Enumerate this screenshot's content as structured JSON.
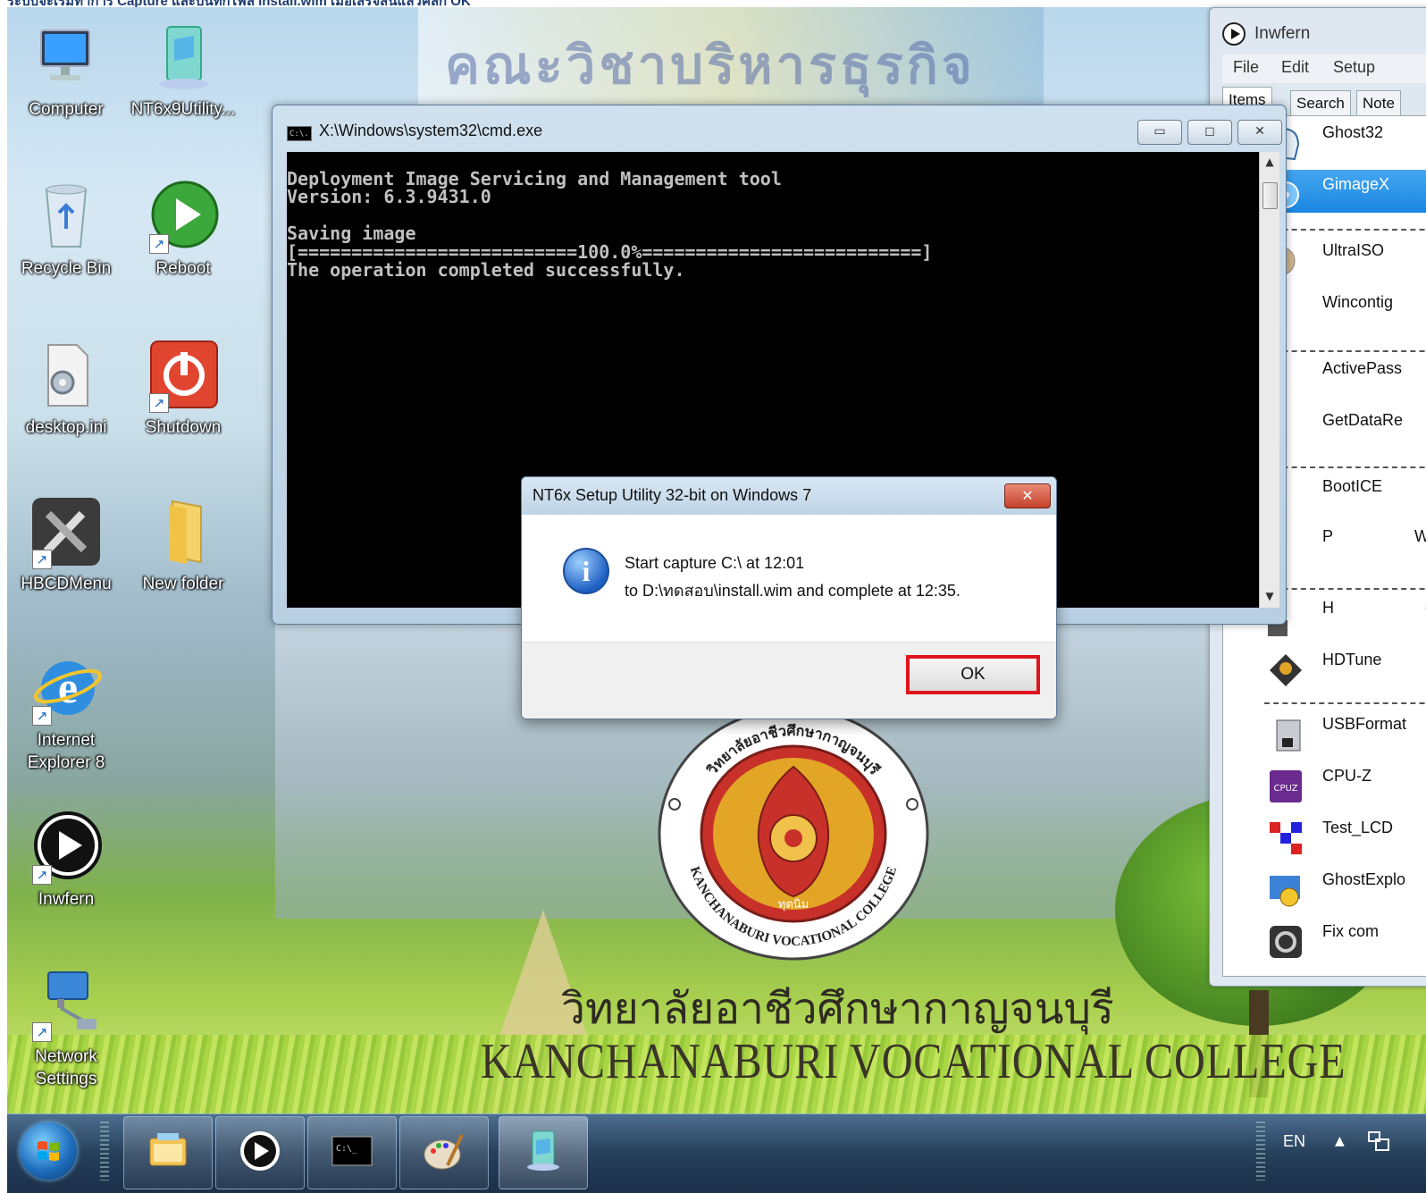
{
  "caption": {
    "text": "ระบบจะเริ่มทำการ Capture และบันทึกไฟล์ install.wim เมื่อเสร็จสิ้นแล้วคลิก OK"
  },
  "desktop": {
    "icons": [
      {
        "label": "Computer"
      },
      {
        "label": "NT6x9Utility..."
      },
      {
        "label": "Recycle Bin"
      },
      {
        "label": "Reboot"
      },
      {
        "label": "desktop.ini"
      },
      {
        "label": "Shutdown"
      },
      {
        "label": "HBCDMenu"
      },
      {
        "label": "New folder"
      },
      {
        "label": "Internet",
        "label2": "Explorer 8"
      },
      {
        "label": "Inwfern"
      },
      {
        "label": "Network",
        "label2": "Settings"
      }
    ],
    "wallpaper": {
      "banner_text": "คณะวิชาบริหารธุรกิจ",
      "seal_top_text": "วิทยาลัยอาชีวศึกษากาญจนบุรี",
      "seal_bottom_text": "KANCHANABURI VOCATIONAL COLLEGE",
      "seal_motto": "ทุตนิม",
      "college_name_th": "วิทยาลัยอาชีวศึกษากาญจนบุรี",
      "college_name_en": "KANCHANABURI  VOCATIONAL  COLLEGE"
    }
  },
  "cmd_window": {
    "title": "X:\\Windows\\system32\\cmd.exe",
    "icon_text": "C:\\.",
    "minimize": "▭",
    "maximize": "◻",
    "close": "✕",
    "console_lines": [
      "Deployment Image Servicing and Management tool",
      "Version: 6.3.9431.0",
      "",
      "Saving image",
      "[==========================100.0%==========================]",
      "The operation completed successfully."
    ]
  },
  "inwfern": {
    "title": "Inwfern",
    "menu": [
      "File",
      "Edit",
      "Setup"
    ],
    "tabs": [
      "Items",
      "Search",
      "Note"
    ],
    "items": [
      {
        "label": "Ghost32",
        "icon": "ghost-icon",
        "selected": false
      },
      {
        "label": "GimageX",
        "icon": "gimagex-icon",
        "selected": true
      },
      {
        "label": "UltraISO",
        "icon": "disc-icon",
        "selected": false
      },
      {
        "label": "Wincontig",
        "icon": "defrag-icon",
        "selected": false
      },
      {
        "label": "ActivePass",
        "icon": "key-icon",
        "selected": false
      },
      {
        "label": "GetDataRe",
        "icon": "recover-icon",
        "selected": false
      },
      {
        "label": "BootICE",
        "icon": "boot-icon",
        "selected": false
      },
      {
        "label": "P",
        "suffix": "Wi",
        "icon": "partition-icon",
        "selected": false
      },
      {
        "label": "H",
        "suffix": "e",
        "icon": "hdd-icon",
        "selected": false
      },
      {
        "label": "HDTune",
        "icon": "hdtune-icon",
        "selected": false
      },
      {
        "label": "USBFormat",
        "icon": "usb-icon",
        "selected": false
      },
      {
        "label": "CPU-Z",
        "icon": "cpuz-icon",
        "selected": false
      },
      {
        "label": "Test_LCD",
        "icon": "lcd-icon",
        "selected": false
      },
      {
        "label": "GhostExplo",
        "icon": "ghost-explorer-icon",
        "selected": false
      },
      {
        "label": "Fix com",
        "icon": "gear-icon",
        "selected": false
      }
    ]
  },
  "dialog": {
    "title": "NT6x Setup Utility 32-bit on Windows 7",
    "close": "✕",
    "info_glyph": "i",
    "line1": "Start capture C:\\ at 12:01",
    "line2": "to D:\\ทดสอบ\\install.wim and complete at 12:35.",
    "ok": "OK",
    "highlight_color": "#e0141e"
  },
  "taskbar": {
    "buttons": [
      "file-explorer-icon",
      "inwfern-player-icon",
      "cmd-icon",
      "paint-icon",
      "nt6x-utility-icon"
    ],
    "cmd_icon_text": "C:\\_",
    "tray_lang": "EN",
    "tray_arrow": "▲"
  }
}
